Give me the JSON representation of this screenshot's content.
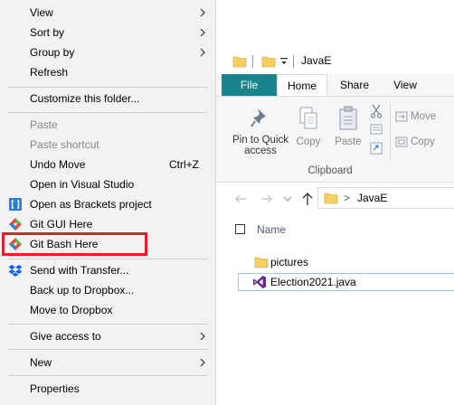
{
  "context_menu": {
    "items": {
      "view": "View",
      "sort_by": "Sort by",
      "group_by": "Group by",
      "refresh": "Refresh",
      "customize": "Customize this folder...",
      "paste": "Paste",
      "paste_shortcut": "Paste shortcut",
      "undo_move": "Undo Move",
      "undo_shortcut": "Ctrl+Z",
      "open_vs": "Open in Visual Studio",
      "open_brackets": "Open as Brackets project",
      "git_gui": "Git GUI Here",
      "git_bash": "Git Bash Here",
      "send_transfer": "Send with Transfer...",
      "backup_dropbox": "Back up to Dropbox...",
      "move_dropbox": "Move to Dropbox",
      "give_access": "Give access to",
      "new": "New",
      "properties": "Properties"
    }
  },
  "explorer": {
    "title": "JavaE",
    "tabs": {
      "file": "File",
      "home": "Home",
      "share": "Share",
      "view": "View"
    },
    "ribbon": {
      "pin_line1": "Pin to Quick",
      "pin_line2": "access",
      "copy": "Copy",
      "paste": "Paste",
      "move": "Move",
      "copy_to": "Copy",
      "group_label": "Clipboard"
    },
    "address": {
      "separator": ">",
      "folder": "JavaE"
    },
    "column_name": "Name",
    "files": [
      "pictures",
      "Election2021.java"
    ]
  },
  "colors": {
    "file_tab": "#19848c",
    "highlight": "#e0202a",
    "folder": "#f6cf5f",
    "vs_purple": "#6a2c91"
  }
}
